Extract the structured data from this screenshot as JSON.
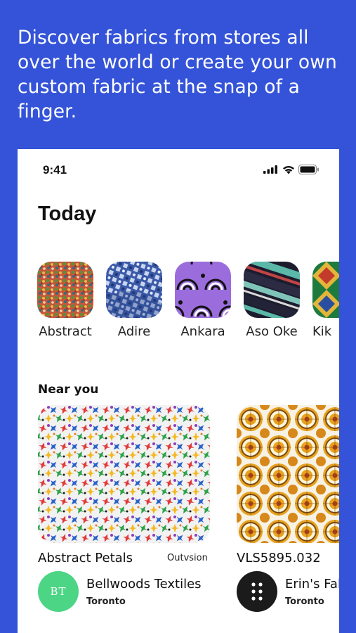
{
  "headline": "Discover fabrics from stores all over the world or create your own custom fabric at the snap of a finger.",
  "status_bar": {
    "time": "9:41",
    "icons": [
      "signal-icon",
      "wifi-icon",
      "battery-icon"
    ]
  },
  "page_title": "Today",
  "categories": [
    {
      "label": "Abstract"
    },
    {
      "label": "Adire"
    },
    {
      "label": "Ankara"
    },
    {
      "label": "Aso Oke"
    },
    {
      "label": "Kik"
    }
  ],
  "near_you": {
    "title": "Near you",
    "items": [
      {
        "name": "Abstract Petals",
        "vendor": "Outvsion"
      },
      {
        "name": "VLS5895.032",
        "vendor": ""
      }
    ]
  },
  "stores": [
    {
      "initials": "BT",
      "name": "Bellwoods Textiles",
      "city": "Toronto",
      "color": "#4cd584"
    },
    {
      "name": "Erin's Fab",
      "city": "Toronto",
      "color": "#1b1b1b"
    }
  ],
  "colors": {
    "background": "#3453d8",
    "card": "#ffffff"
  }
}
